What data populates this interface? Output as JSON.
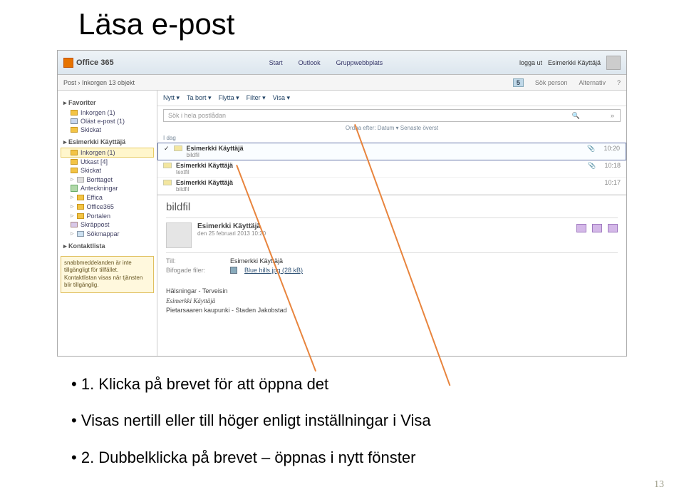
{
  "slide": {
    "title": "Läsa e-post",
    "page_number": "13"
  },
  "app": {
    "logo_text": "Office 365",
    "header_tabs": [
      "Start",
      "Outlook",
      "Gruppwebbplats"
    ],
    "header_right": {
      "signout": "logga ut",
      "user": "Esimerkki Käyttäjä"
    },
    "breadcrumb": "Post  ›  Inkorgen  13 objekt",
    "badge": "5",
    "bc_search_hint": "Sök person",
    "bc_options": "Alternativ",
    "sidebar": {
      "favoriter_title": "Favoriter",
      "favoriter": [
        "Inkorgen (1)",
        "Oläst e-post (1)",
        "Skickat"
      ],
      "mailbox_title": "Esimerkki Käyttäjä",
      "mailbox": [
        "Inkorgen (1)",
        "Utkast [4]",
        "Skickat",
        "Borttaget",
        "Anteckningar",
        "Effica",
        "Office365",
        "Portalen",
        "Skräppost",
        "Sökmappar"
      ],
      "kontakt_title": "Kontaktlista",
      "kontakt_notice": "snabbmeddelanden är inte tillgängligt för tillfället. Kontaktlistan visas när tjänsten blir tillgänglig."
    },
    "toolbar": [
      "Nytt ▾",
      "Ta bort ▾",
      "Flytta ▾",
      "Filter ▾",
      "Visa ▾"
    ],
    "search_placeholder": "Sök i hela postlådan",
    "sort_label": "Ordna efter: Datum ▾   Senaste överst",
    "day_label": "I dag",
    "messages": [
      {
        "from": "Esimerkki Käyttäjä",
        "subject": "bildfil",
        "time": "10:20",
        "selected": true
      },
      {
        "from": "Esimerkki Käyttäjä",
        "subject": "textfil",
        "time": "10:18",
        "selected": false
      },
      {
        "from": "Esimerkki Käyttäjä",
        "subject": "bildfil",
        "time": "10:17",
        "selected": false
      }
    ],
    "preview": {
      "subject": "bildfil",
      "from": "Esimerkki Käyttäjä",
      "date": "den 25 februari 2013 10:20",
      "to_label": "Till:",
      "to_value": "Esimerkki Käyttäjä",
      "att_label": "Bifogade filer:",
      "att_value": "Blue hills.jpg (28 kB)",
      "body_line1": "Hälsningar - Terveisin",
      "body_line2": "Esimerkki Käyttäjä",
      "body_line3": "Pietarsaaren kaupunki - Staden Jakobstad"
    }
  },
  "bullets": {
    "b1": "1. Klicka på brevet för att öppna det",
    "b2": "Visas nertill eller till höger enligt inställningar i Visa",
    "b3": "2. Dubbelklicka på brevet – öppnas i nytt fönster"
  }
}
